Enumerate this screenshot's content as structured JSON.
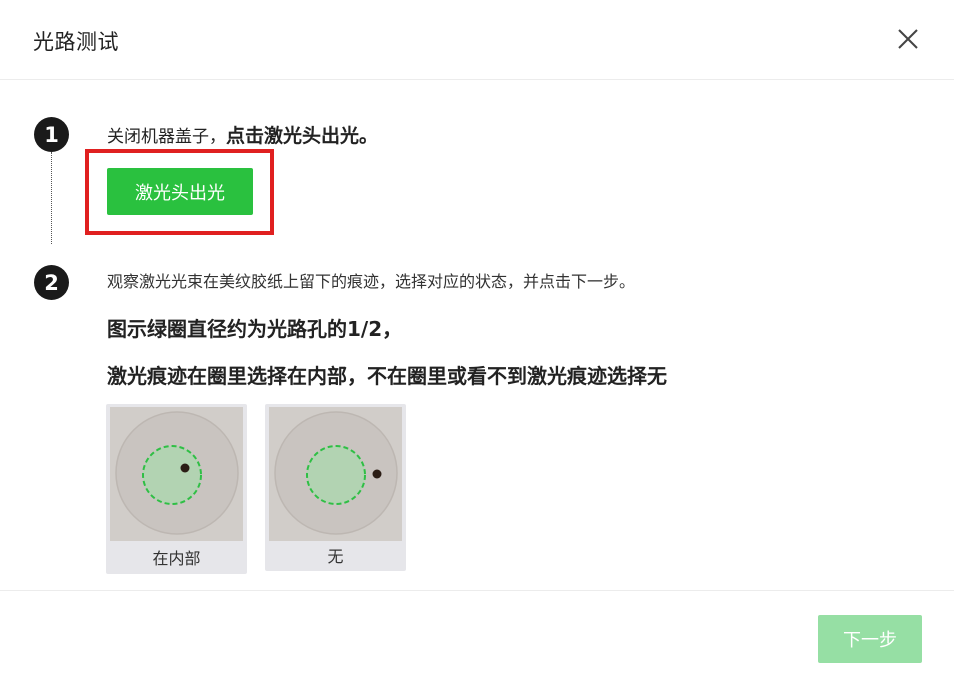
{
  "dialog": {
    "title": "光路测试",
    "close_icon": "close-icon"
  },
  "steps": [
    {
      "number": "1",
      "text_normal": "关闭机器盖子，",
      "text_bold": "点击激光头出光。",
      "button_label": "激光头出光"
    },
    {
      "number": "2",
      "text": "观察激光光束在美纹胶纸上留下的痕迹，选择对应的状态，并点击下一步。",
      "bold_line_1": "图示绿圈直径约为光路孔的1/2，",
      "bold_line_2": "激光痕迹在圈里选择在内部，不在圈里或看不到激光痕迹选择无",
      "options": [
        {
          "label": "在内部"
        },
        {
          "label": "无"
        }
      ]
    }
  ],
  "footer": {
    "next_label": "下一步"
  },
  "colors": {
    "primary_green": "#2ac13f",
    "disabled_green": "#96dfa4",
    "highlight_red": "#e02020",
    "badge_dark": "#1a1a1a"
  }
}
